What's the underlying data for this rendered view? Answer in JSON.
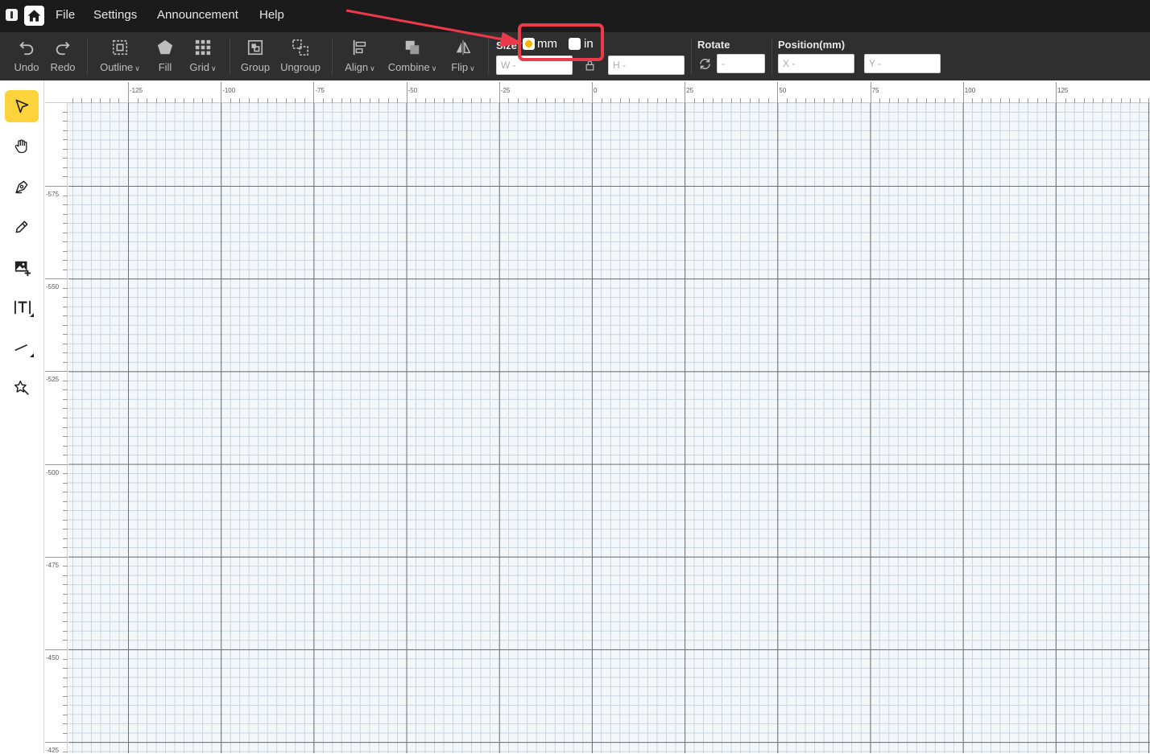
{
  "menubar": {
    "items": [
      "File",
      "Settings",
      "Announcement",
      "Help"
    ]
  },
  "toolbar": {
    "undo": "Undo",
    "redo": "Redo",
    "outline": "Outline",
    "fill": "Fill",
    "grid": "Grid",
    "group": "Group",
    "ungroup": "Ungroup",
    "align": "Align",
    "combine": "Combine",
    "flip": "Flip",
    "size_label": "Size",
    "unit_mm": "mm",
    "unit_in": "in",
    "selected_unit": "mm",
    "w_placeholder": "W -",
    "h_placeholder": "H -",
    "rotate_label": "Rotate",
    "rotate_placeholder": "-",
    "position_label": "Position(mm)",
    "x_placeholder": "X -",
    "y_placeholder": "Y -"
  },
  "left_tools": [
    "select-icon",
    "hand-icon",
    "pen-icon",
    "pencil-icon",
    "add-image-icon",
    "text-icon",
    "line-icon",
    "magic-icon"
  ],
  "ruler": {
    "h_labels": [
      "-125",
      "-100",
      "-75",
      "-50",
      "-25",
      "0",
      "25",
      "50",
      "75",
      "100",
      "125"
    ],
    "v_labels": [
      "-575",
      "-550",
      "-525",
      "-500",
      "-475",
      "-450",
      "-425"
    ]
  },
  "colors": {
    "accent": "#fcd33a",
    "highlight": "#ec3a4a",
    "radio_dot": "#f4b400"
  }
}
